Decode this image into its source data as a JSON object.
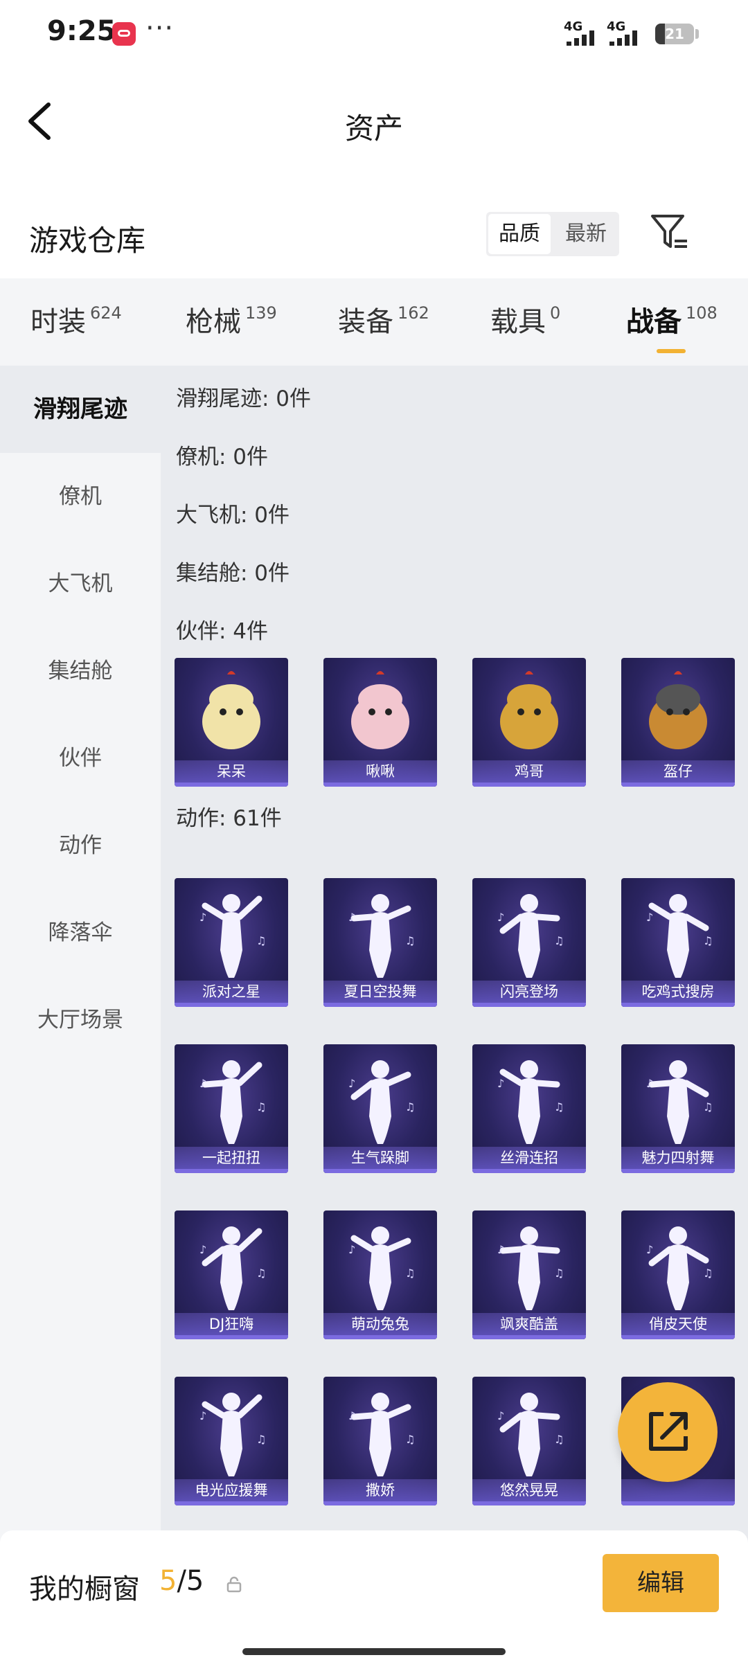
{
  "status_bar": {
    "time": "9:25",
    "more": "···",
    "network1": "4G",
    "network2": "4G",
    "battery": "21"
  },
  "nav": {
    "title": "资产"
  },
  "warehouse": {
    "label": "游戏仓库",
    "sort_options": [
      "品质",
      "最新"
    ],
    "active_sort": "品质"
  },
  "tabs": [
    {
      "label": "时装",
      "count": "624"
    },
    {
      "label": "枪械",
      "count": "139"
    },
    {
      "label": "装备",
      "count": "162"
    },
    {
      "label": "载具",
      "count": "0"
    },
    {
      "label": "战备",
      "count": "108"
    }
  ],
  "active_tab": "战备",
  "sidebar": {
    "items": [
      "滑翔尾迹",
      "僚机",
      "大飞机",
      "集结舱",
      "伙伴",
      "动作",
      "降落伞",
      "大厅场景"
    ]
  },
  "sections": {
    "glide": "滑翔尾迹: 0件",
    "wingman": "僚机: 0件",
    "bigplane": "大飞机: 0件",
    "pod": "集结舱: 0件",
    "partner": "伙伴: 4件",
    "action": "动作: 61件"
  },
  "partners": [
    "呆呆",
    "啾啾",
    "鸡哥",
    "盔仔"
  ],
  "actions": [
    "派对之星",
    "夏日空投舞",
    "闪亮登场",
    "吃鸡式搜房",
    "一起扭扭",
    "生气跺脚",
    "丝滑连招",
    "魅力四射舞",
    "DJ狂嗨",
    "萌动兔兔",
    "飒爽酷盖",
    "俏皮天使",
    "电光应援舞",
    "撒娇",
    "悠然晃晃",
    ""
  ],
  "showcase": {
    "label": "我的橱窗",
    "used": "5",
    "total": "/5",
    "edit": "编辑"
  },
  "colors": {
    "accent": "#f3b43a",
    "card_bg": "#2a2460",
    "card_caption": "#7b6be0"
  }
}
